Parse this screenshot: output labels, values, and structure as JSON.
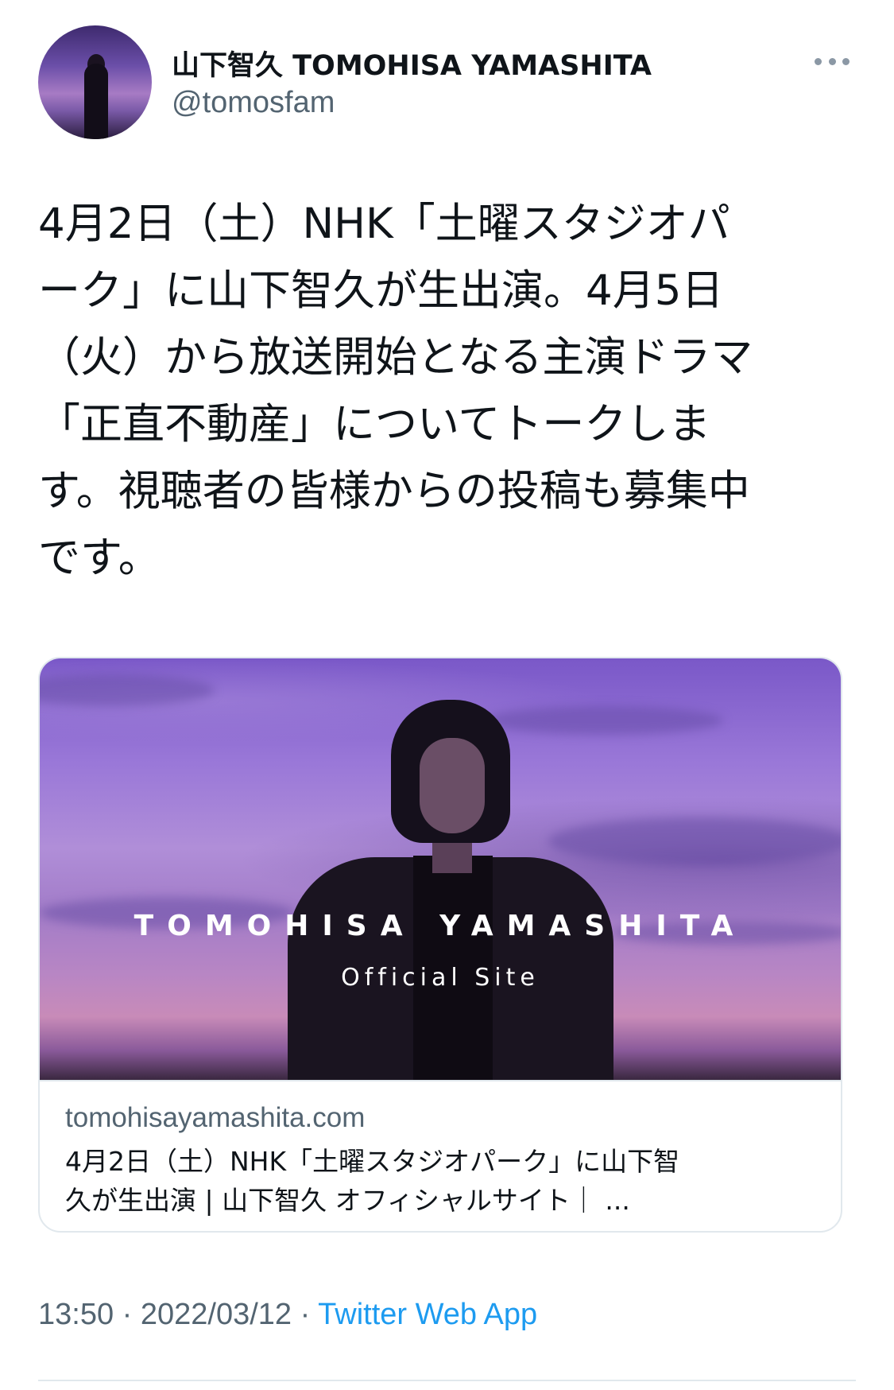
{
  "user": {
    "display_name": "山下智久 TOMOHISA YAMASHITA",
    "handle": "@tomosfam"
  },
  "tweet": {
    "text": "4月2日（土）NHK「土曜スタジオパ\nーク」に山下智久が生出演。4月5日\n（火）から放送開始となる主演ドラマ\n「正直不動産」についてトークしま\nす。視聴者の皆様からの投稿も募集中\nです。"
  },
  "card": {
    "image_title": "TOMOHISA YAMASHITA",
    "image_subtitle": "Official Site",
    "domain": "tomohisayamashita.com",
    "title": "4月2日（土）NHK「土曜スタジオパーク」に山下智\n久が生出演 | 山下智久 オフィシャルサイト｜ ..."
  },
  "meta": {
    "time": "13:50",
    "separator": " · ",
    "date": "2022/03/12",
    "source": "Twitter Web App"
  },
  "colors": {
    "text_primary": "#0f1419",
    "text_secondary": "#536471",
    "link": "#1d9bf0",
    "border": "#e1e8ed"
  },
  "icons": {
    "more": "more-horizontal-icon"
  }
}
